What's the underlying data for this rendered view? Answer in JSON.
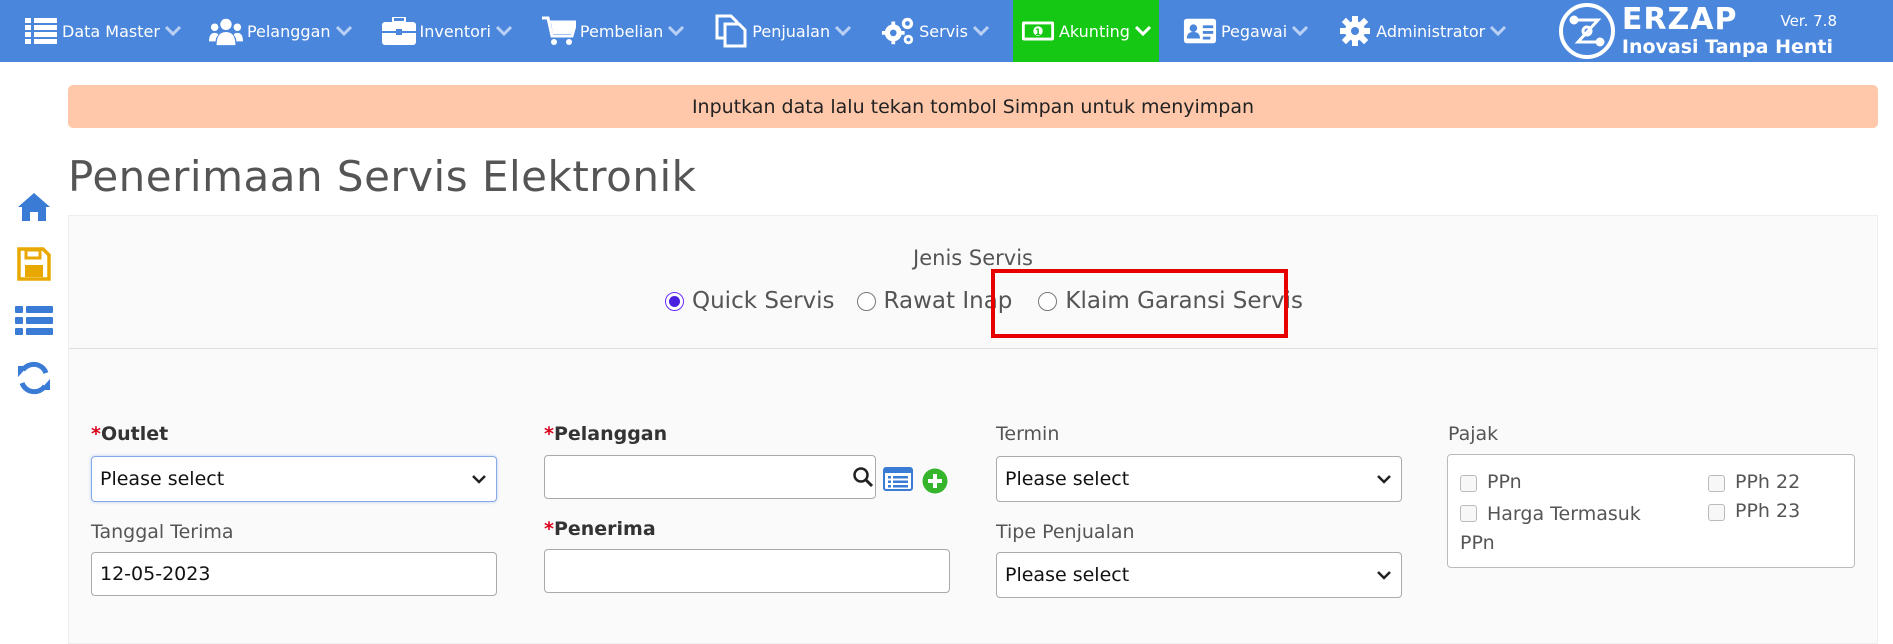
{
  "nav": {
    "items": [
      {
        "label": "Data Master",
        "icon": "list-icon"
      },
      {
        "label": "Pelanggan",
        "icon": "users-icon"
      },
      {
        "label": "Inventori",
        "icon": "briefcase-icon"
      },
      {
        "label": "Pembelian",
        "icon": "cart-icon"
      },
      {
        "label": "Penjualan",
        "icon": "document-icon"
      },
      {
        "label": "Servis",
        "icon": "gears-icon"
      },
      {
        "label": "Akunting",
        "icon": "money-icon",
        "active": true
      },
      {
        "label": "Pegawai",
        "icon": "id-card-icon"
      },
      {
        "label": "Administrator",
        "icon": "gear-icon"
      }
    ],
    "active_color": "#14c814",
    "bar_color": "#4a86dc"
  },
  "brand": {
    "name": "ERZAP",
    "tagline": "Inovasi Tanpa Henti",
    "version": "Ver. 7.8"
  },
  "banner": {
    "message": "Inputkan data lalu tekan tombol Simpan untuk menyimpan",
    "color": "#ffc8ab"
  },
  "page": {
    "title": "Penerimaan Servis Elektronik"
  },
  "sidebar": {
    "icons": [
      "home-icon",
      "save-icon",
      "list-icon",
      "refresh-icon"
    ]
  },
  "jenis_servis": {
    "label": "Jenis Servis",
    "options": [
      {
        "label": "Quick Servis",
        "checked": true
      },
      {
        "label": "Rawat Inap",
        "checked": false
      },
      {
        "label": "Klaim Garansi Servis",
        "checked": false
      }
    ],
    "highlight_color": "#e60000"
  },
  "form": {
    "outlet": {
      "label": "Outlet",
      "required": "*",
      "value": "Please select"
    },
    "tanggal_terima": {
      "label": "Tanggal Terima",
      "value": "12-05-2023"
    },
    "pelanggan": {
      "label": "Pelanggan",
      "required": "*",
      "value": ""
    },
    "penerima": {
      "label": "Penerima",
      "required": "*",
      "value": ""
    },
    "termin": {
      "label": "Termin",
      "value": "Please select"
    },
    "tipe_penjualan": {
      "label": "Tipe Penjualan",
      "value": "Please select"
    },
    "pajak": {
      "label": "Pajak",
      "options": [
        {
          "label": "PPn",
          "checked": false
        },
        {
          "label": "PPh 22",
          "checked": false
        },
        {
          "label": "Harga Termasuk PPn",
          "checked": false
        },
        {
          "label": "PPh 23",
          "checked": false
        }
      ]
    }
  }
}
